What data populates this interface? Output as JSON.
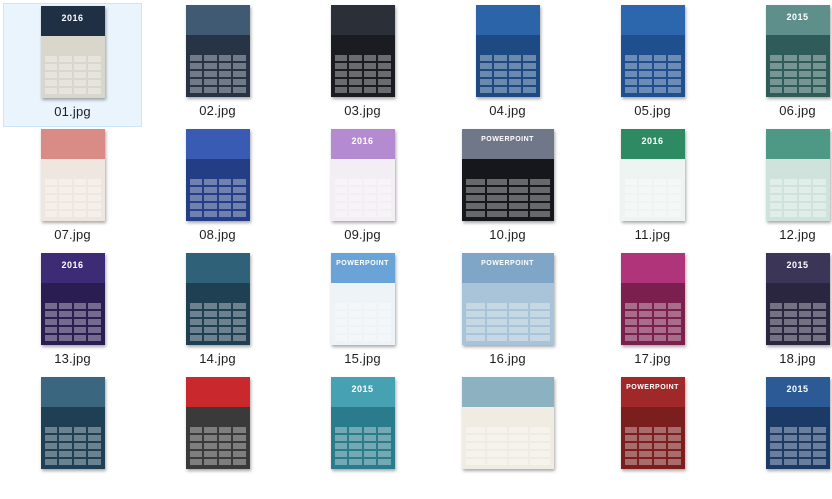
{
  "files": [
    {
      "name": "01.jpg",
      "bg": "#d9d6cc",
      "hero": "#1f2f44",
      "text": "2016",
      "selected": true,
      "shape": "port"
    },
    {
      "name": "02.jpg",
      "bg": "#263446",
      "hero": "#415a74",
      "text": "",
      "selected": false,
      "shape": "port"
    },
    {
      "name": "03.jpg",
      "bg": "#1a1c22",
      "hero": "#2b2f37",
      "text": "",
      "selected": false,
      "shape": "port"
    },
    {
      "name": "04.jpg",
      "bg": "#1d4a82",
      "hero": "#2b65a8",
      "text": "",
      "selected": false,
      "shape": "port"
    },
    {
      "name": "05.jpg",
      "bg": "#1f4f8e",
      "hero": "#2c67ad",
      "text": "",
      "selected": false,
      "shape": "port"
    },
    {
      "name": "06.jpg",
      "bg": "#2f5c5a",
      "hero": "#5f8f8b",
      "text": "2015",
      "selected": false,
      "shape": "port"
    },
    {
      "name": "07.jpg",
      "bg": "#efe6df",
      "hero": "#d98c86",
      "text": "",
      "selected": false,
      "shape": "port"
    },
    {
      "name": "08.jpg",
      "bg": "#243e86",
      "hero": "#3a5bb3",
      "text": "",
      "selected": false,
      "shape": "port"
    },
    {
      "name": "09.jpg",
      "bg": "#f3eef3",
      "hero": "#b48ad0",
      "text": "2016",
      "selected": false,
      "shape": "port"
    },
    {
      "name": "10.jpg",
      "bg": "#15171c",
      "hero": "#6f7789",
      "text": "POWERPOINT",
      "selected": false,
      "shape": "land"
    },
    {
      "name": "11.jpg",
      "bg": "#eef4f1",
      "hero": "#2d8a63",
      "text": "2016",
      "selected": false,
      "shape": "port"
    },
    {
      "name": "12.jpg",
      "bg": "#cfe3dc",
      "hero": "#4e9985",
      "text": "",
      "selected": false,
      "shape": "port"
    },
    {
      "name": "13.jpg",
      "bg": "#2a1d52",
      "hero": "#3d2c75",
      "text": "2016",
      "selected": false,
      "shape": "port"
    },
    {
      "name": "14.jpg",
      "bg": "#1f3f52",
      "hero": "#2f6178",
      "text": "",
      "selected": false,
      "shape": "port"
    },
    {
      "name": "15.jpg",
      "bg": "#eef3f8",
      "hero": "#6aa3d8",
      "text": "POWERPOINT",
      "selected": false,
      "shape": "port"
    },
    {
      "name": "16.jpg",
      "bg": "#a9c3d8",
      "hero": "#7fa6c6",
      "text": "POWERPOINT",
      "selected": false,
      "shape": "land"
    },
    {
      "name": "17.jpg",
      "bg": "#7a1f4e",
      "hero": "#b0347a",
      "text": "",
      "selected": false,
      "shape": "port"
    },
    {
      "name": "18.jpg",
      "bg": "#2a2640",
      "hero": "#3b3558",
      "text": "2015",
      "selected": false,
      "shape": "port"
    },
    {
      "name": "",
      "bg": "#1f3f54",
      "hero": "#3b6680",
      "text": "",
      "selected": false,
      "shape": "port"
    },
    {
      "name": "",
      "bg": "#3a3a3a",
      "hero": "#c9282c",
      "text": "",
      "selected": false,
      "shape": "port"
    },
    {
      "name": "",
      "bg": "#2a7c8c",
      "hero": "#46a2b2",
      "text": "2015",
      "selected": false,
      "shape": "port"
    },
    {
      "name": "",
      "bg": "#f1ece2",
      "hero": "#8cb2c2",
      "text": "",
      "selected": false,
      "shape": "land"
    },
    {
      "name": "",
      "bg": "#7a1e1e",
      "hero": "#a02828",
      "text": "POWERPOINT",
      "selected": false,
      "shape": "port"
    },
    {
      "name": "",
      "bg": "#1c3a66",
      "hero": "#2b5a94",
      "text": "2015",
      "selected": false,
      "shape": "port"
    }
  ]
}
